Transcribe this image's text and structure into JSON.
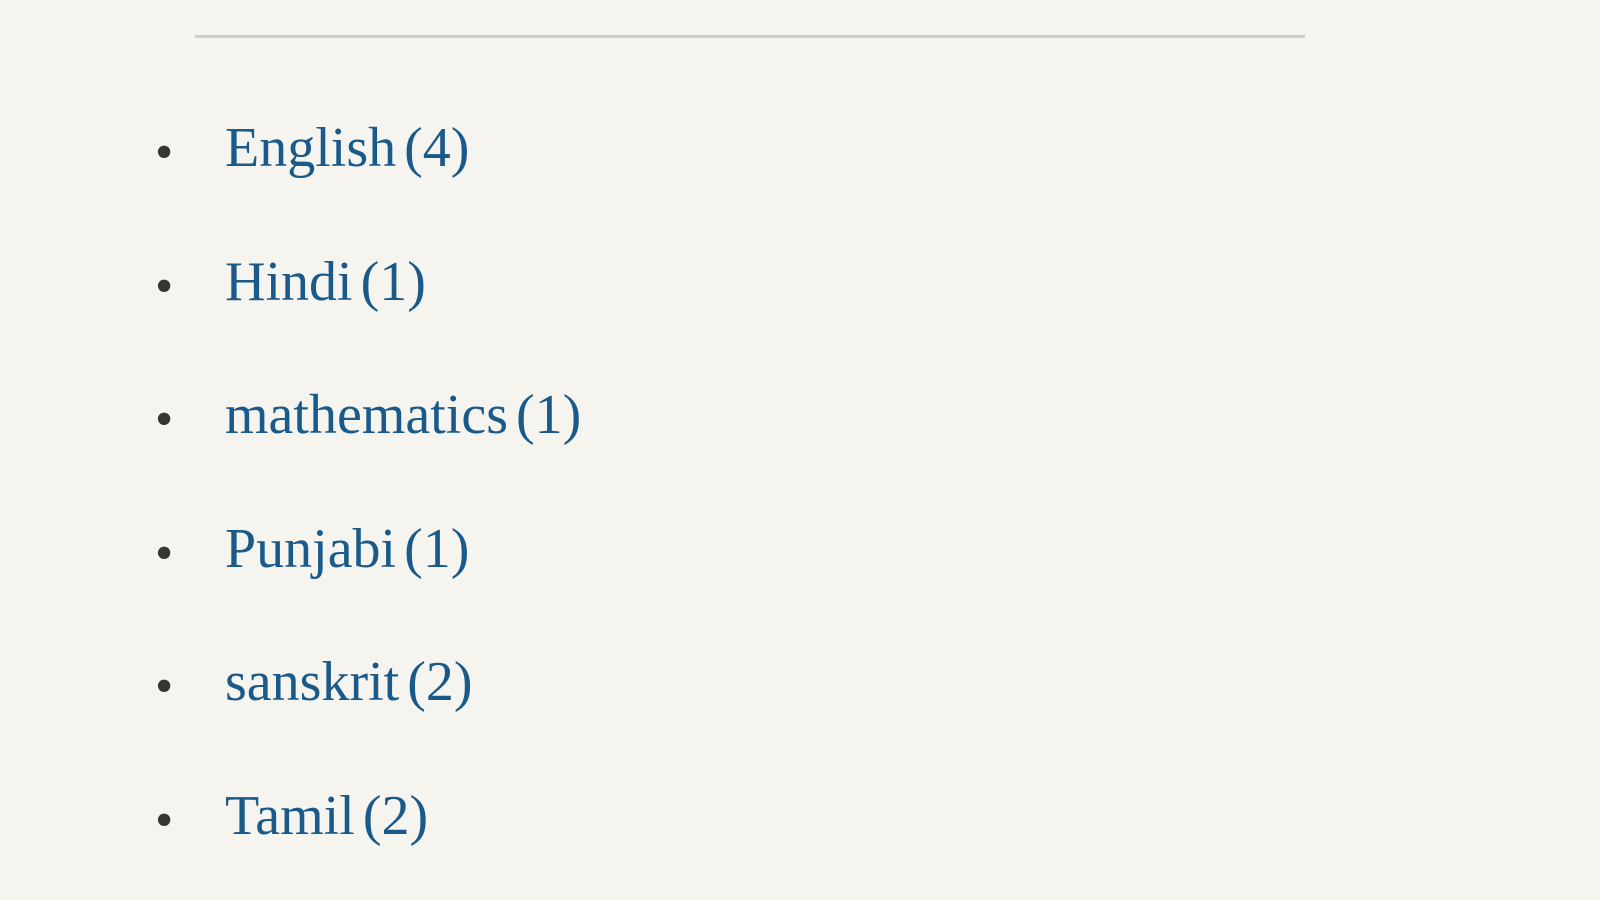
{
  "categories": [
    {
      "label": "English",
      "count": "(4)"
    },
    {
      "label": "Hindi",
      "count": "(1)"
    },
    {
      "label": "mathematics",
      "count": "(1)"
    },
    {
      "label": "Punjabi",
      "count": "(1)"
    },
    {
      "label": "sanskrit",
      "count": "(2)"
    },
    {
      "label": "Tamil",
      "count": "(2)"
    }
  ]
}
